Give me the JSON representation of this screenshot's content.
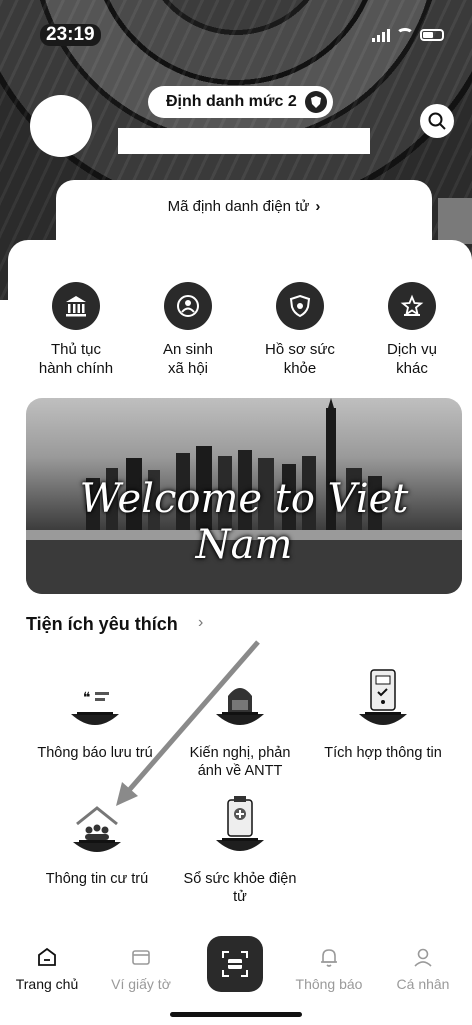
{
  "status": {
    "time": "23:19"
  },
  "header": {
    "level_label": "Định danh mức 2",
    "id_link": "Mã định danh điện tử",
    "id_link_chevron": "›"
  },
  "services": [
    {
      "label_line1": "Thủ tục",
      "label_line2": "hành chính",
      "icon": "government-building-icon"
    },
    {
      "label_line1": "An sinh",
      "label_line2": "xã hội",
      "icon": "social-welfare-icon"
    },
    {
      "label_line1": "Hồ sơ sức",
      "label_line2": "khỏe",
      "icon": "health-shield-icon"
    },
    {
      "label_line1": "Dịch vụ",
      "label_line2": "khác",
      "icon": "other-services-icon"
    }
  ],
  "banner": {
    "text": "Welcome to Viet Nam"
  },
  "favorites": {
    "title": "Tiện ích yêu thích",
    "more": "›",
    "items": [
      {
        "line1": "Thông báo lưu trú",
        "line2": ""
      },
      {
        "line1": "Kiến nghị, phản",
        "line2": "ánh về ANTT"
      },
      {
        "line1": "Tích hợp thông tin",
        "line2": ""
      },
      {
        "line1": "Thông tin cư trú",
        "line2": ""
      },
      {
        "line1": "Sổ sức khỏe điện",
        "line2": "tử"
      }
    ]
  },
  "nav": {
    "home": "Trang chủ",
    "wallet": "Ví giấy tờ",
    "notifications": "Thông báo",
    "profile": "Cá nhân"
  }
}
